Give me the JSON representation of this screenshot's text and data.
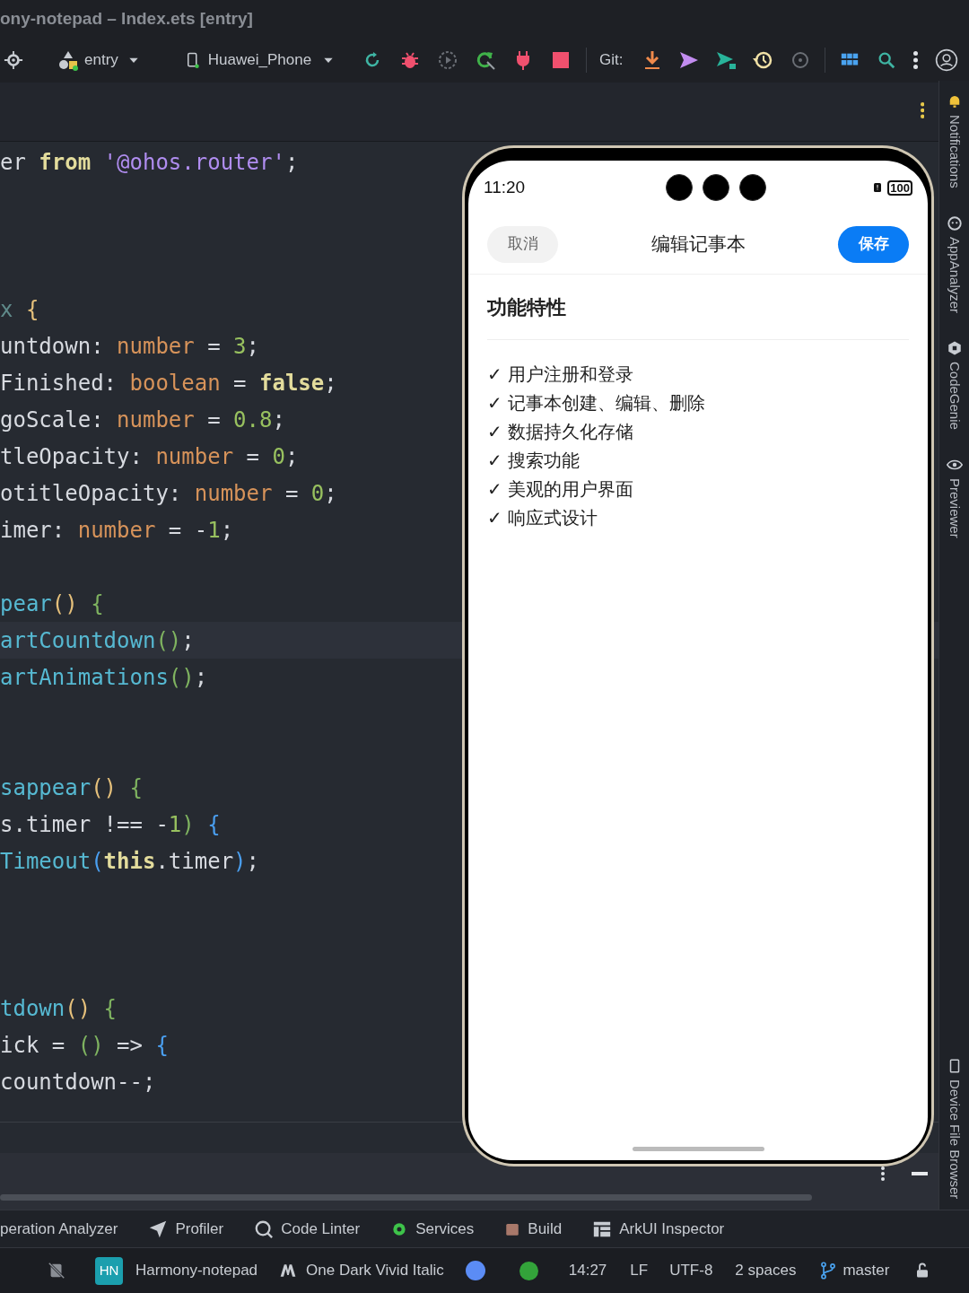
{
  "window": {
    "title": "ony-notepad – Index.ets [entry]"
  },
  "toolbar": {
    "module": "entry",
    "device": "Huawei_Phone",
    "git_label": "Git:"
  },
  "editor": {
    "lines": [
      {
        "kind": "code",
        "current": false,
        "tokens": [
          {
            "kind": "plain",
            "text": "er "
          },
          {
            "kind": "keyword",
            "text": "from "
          },
          {
            "kind": "string",
            "text": "'@ohos.router'"
          },
          {
            "kind": "plain",
            "text": ";"
          }
        ]
      },
      {
        "kind": "blank"
      },
      {
        "kind": "blank"
      },
      {
        "kind": "blank"
      },
      {
        "kind": "code",
        "current": false,
        "tokens": [
          {
            "kind": "dim",
            "text": "x "
          },
          {
            "kind": "bracket1",
            "text": "{"
          }
        ]
      },
      {
        "kind": "code",
        "current": false,
        "tokens": [
          {
            "kind": "plain",
            "text": "untdown: "
          },
          {
            "kind": "type",
            "text": "number"
          },
          {
            "kind": "plain",
            "text": " = "
          },
          {
            "kind": "number",
            "text": "3"
          },
          {
            "kind": "plain",
            "text": ";"
          }
        ]
      },
      {
        "kind": "code",
        "current": false,
        "tokens": [
          {
            "kind": "plain",
            "text": "Finished: "
          },
          {
            "kind": "type",
            "text": "boolean"
          },
          {
            "kind": "plain",
            "text": " = "
          },
          {
            "kind": "keyword",
            "text": "false"
          },
          {
            "kind": "plain",
            "text": ";"
          }
        ]
      },
      {
        "kind": "code",
        "current": false,
        "tokens": [
          {
            "kind": "plain",
            "text": "goScale: "
          },
          {
            "kind": "type",
            "text": "number"
          },
          {
            "kind": "plain",
            "text": " = "
          },
          {
            "kind": "number",
            "text": "0.8"
          },
          {
            "kind": "plain",
            "text": ";"
          }
        ]
      },
      {
        "kind": "code",
        "current": false,
        "tokens": [
          {
            "kind": "plain",
            "text": "tleOpacity: "
          },
          {
            "kind": "type",
            "text": "number"
          },
          {
            "kind": "plain",
            "text": " = "
          },
          {
            "kind": "number",
            "text": "0"
          },
          {
            "kind": "plain",
            "text": ";"
          }
        ]
      },
      {
        "kind": "code",
        "current": false,
        "tokens": [
          {
            "kind": "plain",
            "text": "otitleOpacity: "
          },
          {
            "kind": "type",
            "text": "number"
          },
          {
            "kind": "plain",
            "text": " = "
          },
          {
            "kind": "number",
            "text": "0"
          },
          {
            "kind": "plain",
            "text": ";"
          }
        ]
      },
      {
        "kind": "code",
        "current": false,
        "tokens": [
          {
            "kind": "plain",
            "text": "imer: "
          },
          {
            "kind": "type",
            "text": "number"
          },
          {
            "kind": "plain",
            "text": " = -"
          },
          {
            "kind": "number",
            "text": "1"
          },
          {
            "kind": "plain",
            "text": ";"
          }
        ]
      },
      {
        "kind": "blank"
      },
      {
        "kind": "code",
        "current": false,
        "tokens": [
          {
            "kind": "method",
            "text": "pear"
          },
          {
            "kind": "bracket1",
            "text": "() "
          },
          {
            "kind": "bracket2",
            "text": "{"
          }
        ]
      },
      {
        "kind": "code",
        "current": true,
        "tokens": [
          {
            "kind": "method",
            "text": "artCountdown"
          },
          {
            "kind": "bracket2",
            "text": "()"
          },
          {
            "kind": "plain",
            "text": ";"
          }
        ]
      },
      {
        "kind": "code",
        "current": false,
        "tokens": [
          {
            "kind": "method",
            "text": "artAnimations"
          },
          {
            "kind": "bracket2",
            "text": "()"
          },
          {
            "kind": "plain",
            "text": ";"
          }
        ]
      },
      {
        "kind": "blank"
      },
      {
        "kind": "blank"
      },
      {
        "kind": "code",
        "current": false,
        "tokens": [
          {
            "kind": "method",
            "text": "sappear"
          },
          {
            "kind": "bracket1",
            "text": "() "
          },
          {
            "kind": "bracket2",
            "text": "{"
          }
        ]
      },
      {
        "kind": "code",
        "current": false,
        "tokens": [
          {
            "kind": "plain",
            "text": "s.timer !== -"
          },
          {
            "kind": "number",
            "text": "1"
          },
          {
            "kind": "bracket2",
            "text": ") "
          },
          {
            "kind": "bracket3",
            "text": "{"
          }
        ]
      },
      {
        "kind": "code",
        "current": false,
        "tokens": [
          {
            "kind": "method",
            "text": "Timeout"
          },
          {
            "kind": "bracket3",
            "text": "("
          },
          {
            "kind": "keyword",
            "text": "this"
          },
          {
            "kind": "plain",
            "text": ".timer"
          },
          {
            "kind": "bracket3",
            "text": ")"
          },
          {
            "kind": "plain",
            "text": ";"
          }
        ]
      },
      {
        "kind": "blank"
      },
      {
        "kind": "blank"
      },
      {
        "kind": "blank"
      },
      {
        "kind": "code",
        "current": false,
        "tokens": [
          {
            "kind": "method",
            "text": "tdown"
          },
          {
            "kind": "bracket1",
            "text": "() "
          },
          {
            "kind": "bracket2",
            "text": "{"
          }
        ]
      },
      {
        "kind": "code",
        "current": false,
        "tokens": [
          {
            "kind": "plain",
            "text": "ick = "
          },
          {
            "kind": "bracket2",
            "text": "()"
          },
          {
            "kind": "plain",
            "text": " => "
          },
          {
            "kind": "bracket3",
            "text": "{"
          }
        ]
      },
      {
        "kind": "code",
        "current": false,
        "tokens": [
          {
            "kind": "plain",
            "text": "countdown--;"
          }
        ]
      }
    ]
  },
  "preview": {
    "status_time": "11:20",
    "battery": "100",
    "cancel_button": "取消",
    "title": "编辑记事本",
    "save_button": "保存",
    "section_title": "功能特性",
    "features": [
      "✓ 用户注册和登录",
      "✓ 记事本创建、编辑、删除",
      "✓ 数据持久化存储",
      "✓ 搜索功能",
      "✓ 美观的用户界面",
      "✓ 响应式设计"
    ]
  },
  "right_sidebar": [
    "Notifications",
    "AppAnalyzer",
    "CodeGenie",
    "Previewer",
    "Device File Browser"
  ],
  "tool_tabs": [
    "peration Analyzer",
    "Profiler",
    "Code Linter",
    "Services",
    "Build",
    "ArkUI Inspector"
  ],
  "status_bar": {
    "project_badge": "HN",
    "project": "Harmony-notepad",
    "theme": "One Dark Vivid Italic",
    "position": "14:27",
    "line_separator": "LF",
    "encoding": "UTF-8",
    "indent": "2 spaces",
    "branch": "master"
  }
}
